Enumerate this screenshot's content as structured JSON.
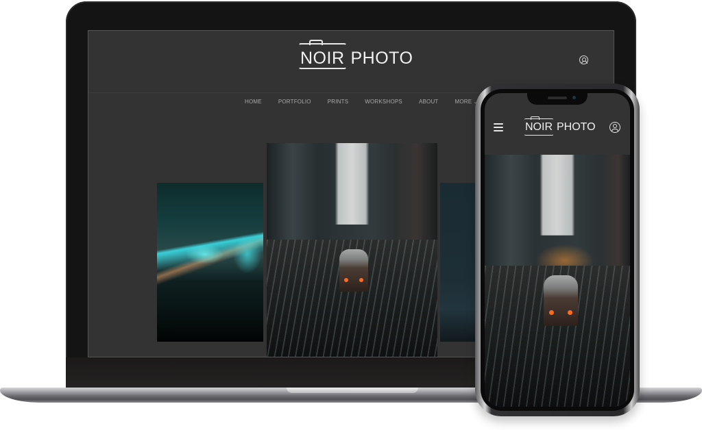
{
  "desktop": {
    "logo": {
      "mark": "NOIR",
      "text": "PHOTO"
    },
    "nav": [
      {
        "label": "HOME"
      },
      {
        "label": "PORTFOLIO"
      },
      {
        "label": "PRINTS"
      },
      {
        "label": "WORKSHOPS"
      },
      {
        "label": "ABOUT"
      },
      {
        "label": "MORE",
        "icon": "chevron-down-icon"
      }
    ],
    "account_icon": "user-circle-icon",
    "gallery": [
      {
        "name": "teal light-trail tunnel"
      },
      {
        "name": "elevated train at night"
      },
      {
        "name": "blue city night (partial)"
      }
    ]
  },
  "mobile": {
    "menu_icon": "hamburger-icon",
    "logo": {
      "mark": "NOIR",
      "text": "PHOTO"
    },
    "account_icon": "user-circle-icon",
    "hero": {
      "name": "elevated train at night"
    }
  },
  "colors": {
    "page_bg": "#333333",
    "text": "#f1f1f1",
    "nav_text": "#a9a9a9",
    "accent_orange": "#ff6a21",
    "accent_teal": "#3ce6f0"
  }
}
